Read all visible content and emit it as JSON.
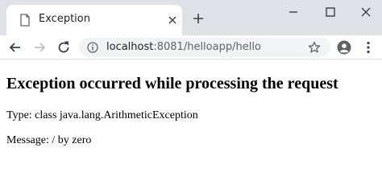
{
  "tab": {
    "title": "Exception"
  },
  "address_bar": {
    "host": "localhost",
    "rest": ":8081/helloapp/hello"
  },
  "page": {
    "heading": "Exception occurred while processing the request",
    "type_line": "Type: class java.lang.ArithmeticException",
    "message_line": "Message: / by zero"
  },
  "icons": {
    "tab": "document-icon",
    "close": "close-icon",
    "new_tab": "plus-icon",
    "back": "back-arrow-icon",
    "forward": "forward-arrow-icon",
    "reload": "reload-icon",
    "info": "info-icon",
    "bookmark": "star-icon",
    "profile": "profile-icon",
    "menu": "kebab-menu-icon"
  },
  "colors": {
    "tabstrip": "#dee1e6",
    "omnibox": "#f1f3f4"
  }
}
